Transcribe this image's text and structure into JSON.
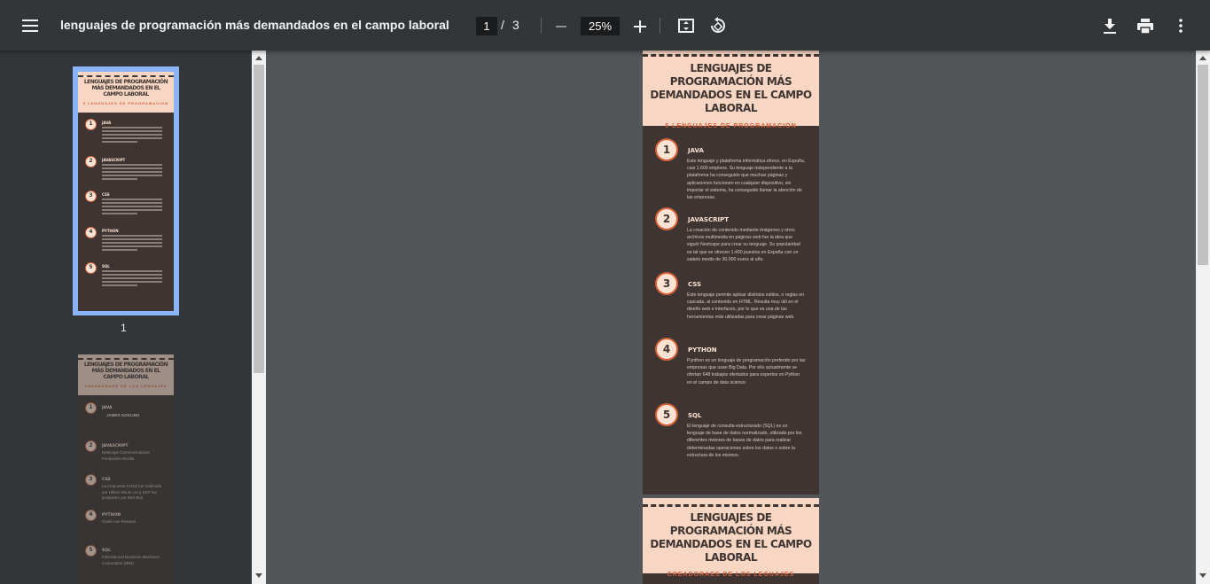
{
  "toolbar": {
    "menu_icon": "hamburger-menu-icon",
    "title": "lenguajes de programación más demandados en el campo laboral",
    "current_page": "1",
    "page_separator": "/",
    "total_pages": "3",
    "zoom": "25%",
    "icons": [
      "minus-icon",
      "plus-icon",
      "fit-page-icon",
      "rotate-icon",
      "download-icon",
      "print-icon",
      "more-vert-icon"
    ]
  },
  "colors": {
    "toolbar_bg": "#323639",
    "viewer_bg": "#525659",
    "page_dark": "#3e3431",
    "page_header": "#f8d6c4",
    "accent": "#d2603a",
    "thumb_selected": "#8ab4f8"
  },
  "thumbnails": [
    {
      "label": "1",
      "title": "LENGUAJES DE PROGRAMACIÓN MÁS DEMANDADOS EN EL CAMPO LABORAL",
      "subtitle": "5 LENGUAJES DE PROGRAMACION",
      "items": [
        {
          "n": "1",
          "name": "JAVA"
        },
        {
          "n": "2",
          "name": "JAVASCRIPT"
        },
        {
          "n": "3",
          "name": "CSS"
        },
        {
          "n": "4",
          "name": "PYTHON"
        },
        {
          "n": "5",
          "name": "SQL"
        }
      ]
    },
    {
      "title": "LENGUAJES DE PROGRAMACIÓN MÁS DEMANDADOS EN EL CAMPO LABORAL",
      "subtitle": "CREADORAES DE LOS LEGUAJES",
      "items": [
        {
          "n": "1",
          "name": "JAVA",
          "desc": "JAMES GOSLING"
        },
        {
          "n": "2",
          "name": "JAVASCRIPT",
          "desc": "Netscape Communications Fundación Mozilla"
        },
        {
          "n": "3",
          "name": "CSS",
          "desc": "La propuesta CHSS fue realizada por Håkon Wium Lie y SSP fue propuesto por Bert Bos"
        },
        {
          "n": "4",
          "name": "PYTHON",
          "desc": "Guido van Rossum"
        },
        {
          "n": "5",
          "name": "SQL",
          "desc": "International Business Machines Corporation (IBM)"
        }
      ]
    }
  ],
  "page1": {
    "title": "LENGUAJES DE PROGRAMACIÓN MÁS DEMANDADOS EN EL CAMPO LABORAL",
    "subtitle": "5 LENGUAJES DE PROGRAMACION",
    "items": [
      {
        "n": "1",
        "name": "JAVA",
        "desc": "Este lenguaje y plataforma informática ofrece, en España, casi 1.600 empleos. Su lenguaje independiente a la plataforma ha conseguido que muchas páginas y aplicaciones funcionen en cualquier dispositivo, sin importar el sistema, ha conseguido llamar la atención de las empresas."
      },
      {
        "n": "2",
        "name": "JAVASCRIPT",
        "desc": "La creación de contenido mediante imágenes y otros archivos multimedia en páginas web fue la idea que siguió Nestcape para crear su lenguaje. Su popularidad es tal que se ofrecen 1.400 puestos en España con un salario medio de 30.000 euros al año."
      },
      {
        "n": "3",
        "name": "CSS",
        "desc": "Este lenguaje permite aplicar distintos estilos, o reglas en cascada, al contenido en HTML. Resulta muy útil en el diseño web e interfaces, por lo que es una de las herramientas más utilizadas para crear páginas web."
      },
      {
        "n": "4",
        "name": "PYTHON",
        "desc": "Pynthon es un lenguaje de programación preferido por las empresas que usan Big Data. Por ello actualmente se ofertan 648 trabajos ofertados para expertos en Python en el campo de data science"
      },
      {
        "n": "5",
        "name": "SQL",
        "desc": "El lenguaje de consulta estructurado (SQL) es un lenguaje de base de datos normalizado, utilizado por los diferentes motores de bases de datos para realizar determinadas operaciones sobre los datos o sobre la estructura de los mismos."
      }
    ]
  },
  "page2": {
    "title": "LENGUAJES DE PROGRAMACIÓN MÁS DEMANDADOS EN EL CAMPO LABORAL",
    "subtitle": "CREADORAES DE LOS LEGUAJES"
  }
}
